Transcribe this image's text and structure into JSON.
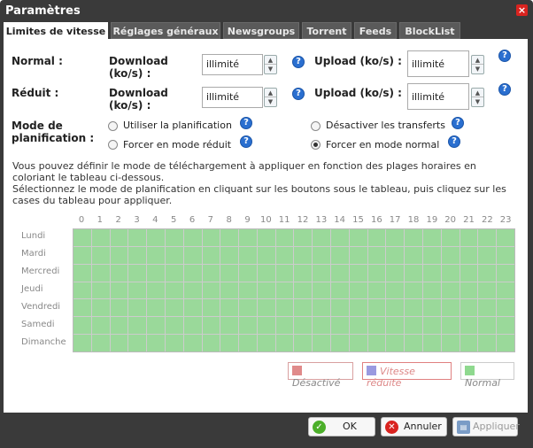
{
  "window": {
    "title": "Paramètres"
  },
  "tabs": [
    {
      "label": "Limites de vitesse",
      "active": true
    },
    {
      "label": "Réglages généraux",
      "active": false
    },
    {
      "label": "Newsgroups",
      "active": false
    },
    {
      "label": "Torrent",
      "active": false
    },
    {
      "label": "Feeds",
      "active": false
    },
    {
      "label": "BlockList",
      "active": false
    }
  ],
  "limits": {
    "normal": {
      "label": "Normal :",
      "download_label": "Download (ko/s) :",
      "download_value": "illimité",
      "upload_label": "Upload (ko/s) :",
      "upload_value": "illimité"
    },
    "reduced": {
      "label": "Réduit :",
      "download_label": "Download (ko/s) :",
      "download_value": "illimité",
      "upload_label": "Upload (ko/s) :",
      "upload_value": "illimité"
    }
  },
  "schedule_mode": {
    "label": "Mode de planification :",
    "options": [
      {
        "label": "Utiliser la planification",
        "selected": false
      },
      {
        "label": "Désactiver les transferts",
        "selected": false
      },
      {
        "label": "Forcer en mode réduit",
        "selected": false
      },
      {
        "label": "Forcer en mode normal",
        "selected": true
      }
    ]
  },
  "description": {
    "line1": "Vous pouvez définir le mode de téléchargement à appliquer en fonction des plages horaires en coloriant le tableau ci-dessous.",
    "line2": "Sélectionnez le mode de planification en cliquant sur les boutons sous le tableau, puis cliquez sur les cases du tableau pour appliquer."
  },
  "schedule": {
    "hours": [
      "0",
      "1",
      "2",
      "3",
      "4",
      "5",
      "6",
      "7",
      "8",
      "9",
      "10",
      "11",
      "12",
      "13",
      "14",
      "15",
      "16",
      "17",
      "18",
      "19",
      "20",
      "21",
      "22",
      "23"
    ],
    "days": [
      "Lundi",
      "Mardi",
      "Mercredi",
      "Jeudi",
      "Vendredi",
      "Samedi",
      "Dimanche"
    ],
    "cell_mode": "Normal"
  },
  "legend": [
    {
      "label": "Désactivé",
      "color": "#e08a8a",
      "border": "#d9a0a0"
    },
    {
      "label": "Vitesse réduite",
      "color": "#9a9ae0",
      "border": "#e08080"
    },
    {
      "label": "Normal",
      "color": "#8fd98f",
      "border": "#bbb"
    }
  ],
  "colors": {
    "cell_normal": "#9ad99a",
    "help_icon": "#2a6fd0",
    "close": "#d9231f"
  },
  "buttons": {
    "ok": "OK",
    "cancel": "Annuler",
    "apply": "Appliquer"
  },
  "icons": {
    "help": "?",
    "close": "×",
    "ok": "✓",
    "cancel": "✕",
    "apply": "💾"
  }
}
